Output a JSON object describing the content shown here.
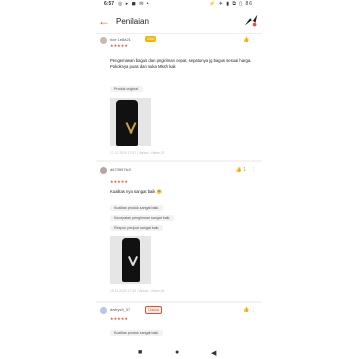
{
  "status": {
    "time": "6:57",
    "left_icons": "◎ ▸ ◼ ✉ •",
    "right_icons": "⚡ ✈ ▮ ⧉ ▯",
    "battery": "86"
  },
  "header": {
    "back_icon": "arrow-left-icon",
    "title": "Penilaian"
  },
  "reviews": [
    {
      "username": "rice 1e8a21",
      "badge": "Gold",
      "stars": "★★★★★",
      "text": "Pengemasan bagus dan pngiriman cepat, sepatunya jg bagus sesuai harga. Pokoknya puas dan suka Mksh kak",
      "chips": [
        "Produk original."
      ],
      "meta": "17-07-2020 17:07 | Variasi : Hitam,37"
    },
    {
      "username": "d673597fc3",
      "stars": "★★★★★",
      "likes": "1",
      "text": "Kualitas nya sangat baik 🤗",
      "chips": [
        "Kualitas produk sangat baik.",
        "Kecepatan pengiriman sangat baik.",
        "Respon penjual sangat baik."
      ],
      "meta": "15-11-2020 17:35 | Variasi : Hitam,39"
    },
    {
      "username": "dwirys9_37",
      "badge": "Classic",
      "stars": "★★★★★",
      "text": "Kualitas produk sangat baik."
    }
  ],
  "nav": {
    "square": "■",
    "circle": "●",
    "back": "◀"
  }
}
